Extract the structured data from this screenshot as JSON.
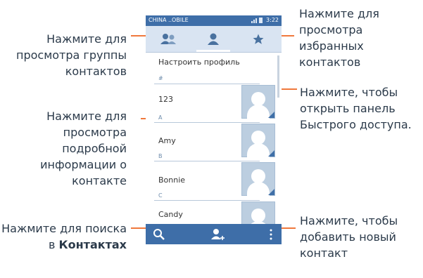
{
  "statusbar": {
    "carrier": "CHINA ..OBILE",
    "time": "3:22"
  },
  "phone_icons": {
    "group_tab": "group-icon",
    "contacts_tab": "contact-icon",
    "favorites_tab": "star-icon",
    "search": "search-icon",
    "add_contact": "add-contact-icon",
    "menu": "more-icon"
  },
  "contacts": {
    "profile_label": "Настроить профиль",
    "sections": [
      {
        "header": "#",
        "name": "123"
      },
      {
        "header": "A",
        "name": "Amy"
      },
      {
        "header": "B",
        "name": "Bonnie"
      },
      {
        "header": "C",
        "name": "Candy"
      }
    ]
  },
  "callouts": {
    "group_view": "Нажмите для просмотра группы контактов",
    "details_view": "Нажмите для просмотра подробной информации о контакте",
    "search": "Нажмите для поиска в",
    "search_bold": "Контактах",
    "favorites": "Нажмите для просмотра избранных контактов",
    "quick_access": "Нажмите, чтобы открыть панель Быстрого доступа.",
    "add_contact": "Нажмите, чтобы добавить новый контакт"
  },
  "colors": {
    "accent": "#3e6ea8",
    "leader": "#f0783c",
    "text": "#2b3a4a"
  }
}
